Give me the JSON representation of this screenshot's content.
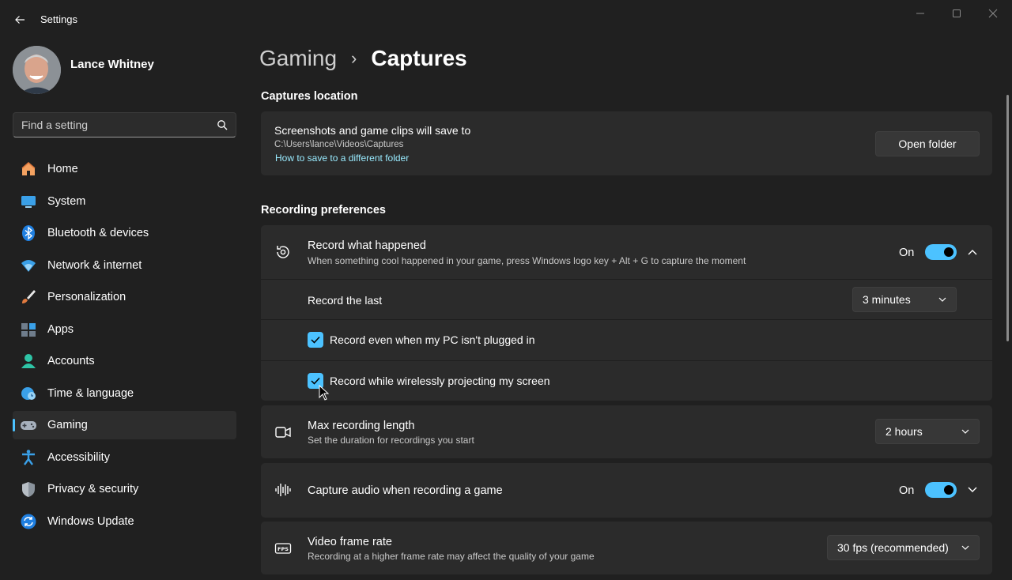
{
  "window": {
    "title": "Settings"
  },
  "user": {
    "name": "Lance Whitney"
  },
  "search": {
    "placeholder": "Find a setting"
  },
  "sidebar": {
    "items": [
      {
        "label": "Home",
        "icon": "home-icon"
      },
      {
        "label": "System",
        "icon": "system-icon"
      },
      {
        "label": "Bluetooth & devices",
        "icon": "bluetooth-icon"
      },
      {
        "label": "Network & internet",
        "icon": "wifi-icon"
      },
      {
        "label": "Personalization",
        "icon": "brush-icon"
      },
      {
        "label": "Apps",
        "icon": "apps-icon"
      },
      {
        "label": "Accounts",
        "icon": "accounts-icon"
      },
      {
        "label": "Time & language",
        "icon": "globe-clock-icon"
      },
      {
        "label": "Gaming",
        "icon": "gamepad-icon",
        "active": true
      },
      {
        "label": "Accessibility",
        "icon": "accessibility-icon"
      },
      {
        "label": "Privacy & security",
        "icon": "shield-icon"
      },
      {
        "label": "Windows Update",
        "icon": "update-icon"
      }
    ]
  },
  "breadcrumb": {
    "parent": "Gaming",
    "separator": "›",
    "current": "Captures"
  },
  "captures_location": {
    "section_title": "Captures location",
    "title": "Screenshots and game clips will save to",
    "path": "C:\\Users\\lance\\Videos\\Captures",
    "link": "How to save to a different folder",
    "button": "Open folder"
  },
  "recording_preferences": {
    "section_title": "Recording preferences",
    "record_what_happened": {
      "title": "Record what happened",
      "desc": "When something cool happened in your game, press Windows logo key + Alt + G to capture the moment",
      "toggle_label": "On",
      "toggle_on": true,
      "expanded": true
    },
    "record_the_last": {
      "title": "Record the last",
      "value": "3 minutes"
    },
    "plugged_in": {
      "label": "Record even when my PC isn't plugged in",
      "checked": true
    },
    "wireless": {
      "label": "Record while wirelessly projecting my screen",
      "checked": true
    },
    "max_length": {
      "title": "Max recording length",
      "desc": "Set the duration for recordings you start",
      "value": "2 hours"
    },
    "capture_audio": {
      "title": "Capture audio when recording a game",
      "toggle_label": "On",
      "toggle_on": true,
      "expanded": false
    },
    "frame_rate": {
      "title": "Video frame rate",
      "desc": "Recording at a higher frame rate may affect the quality of your game",
      "value": "30 fps (recommended)"
    }
  },
  "colors": {
    "accent": "#4cc2ff",
    "background": "#202020",
    "card": "#2b2b2b",
    "link": "#99ebff"
  }
}
